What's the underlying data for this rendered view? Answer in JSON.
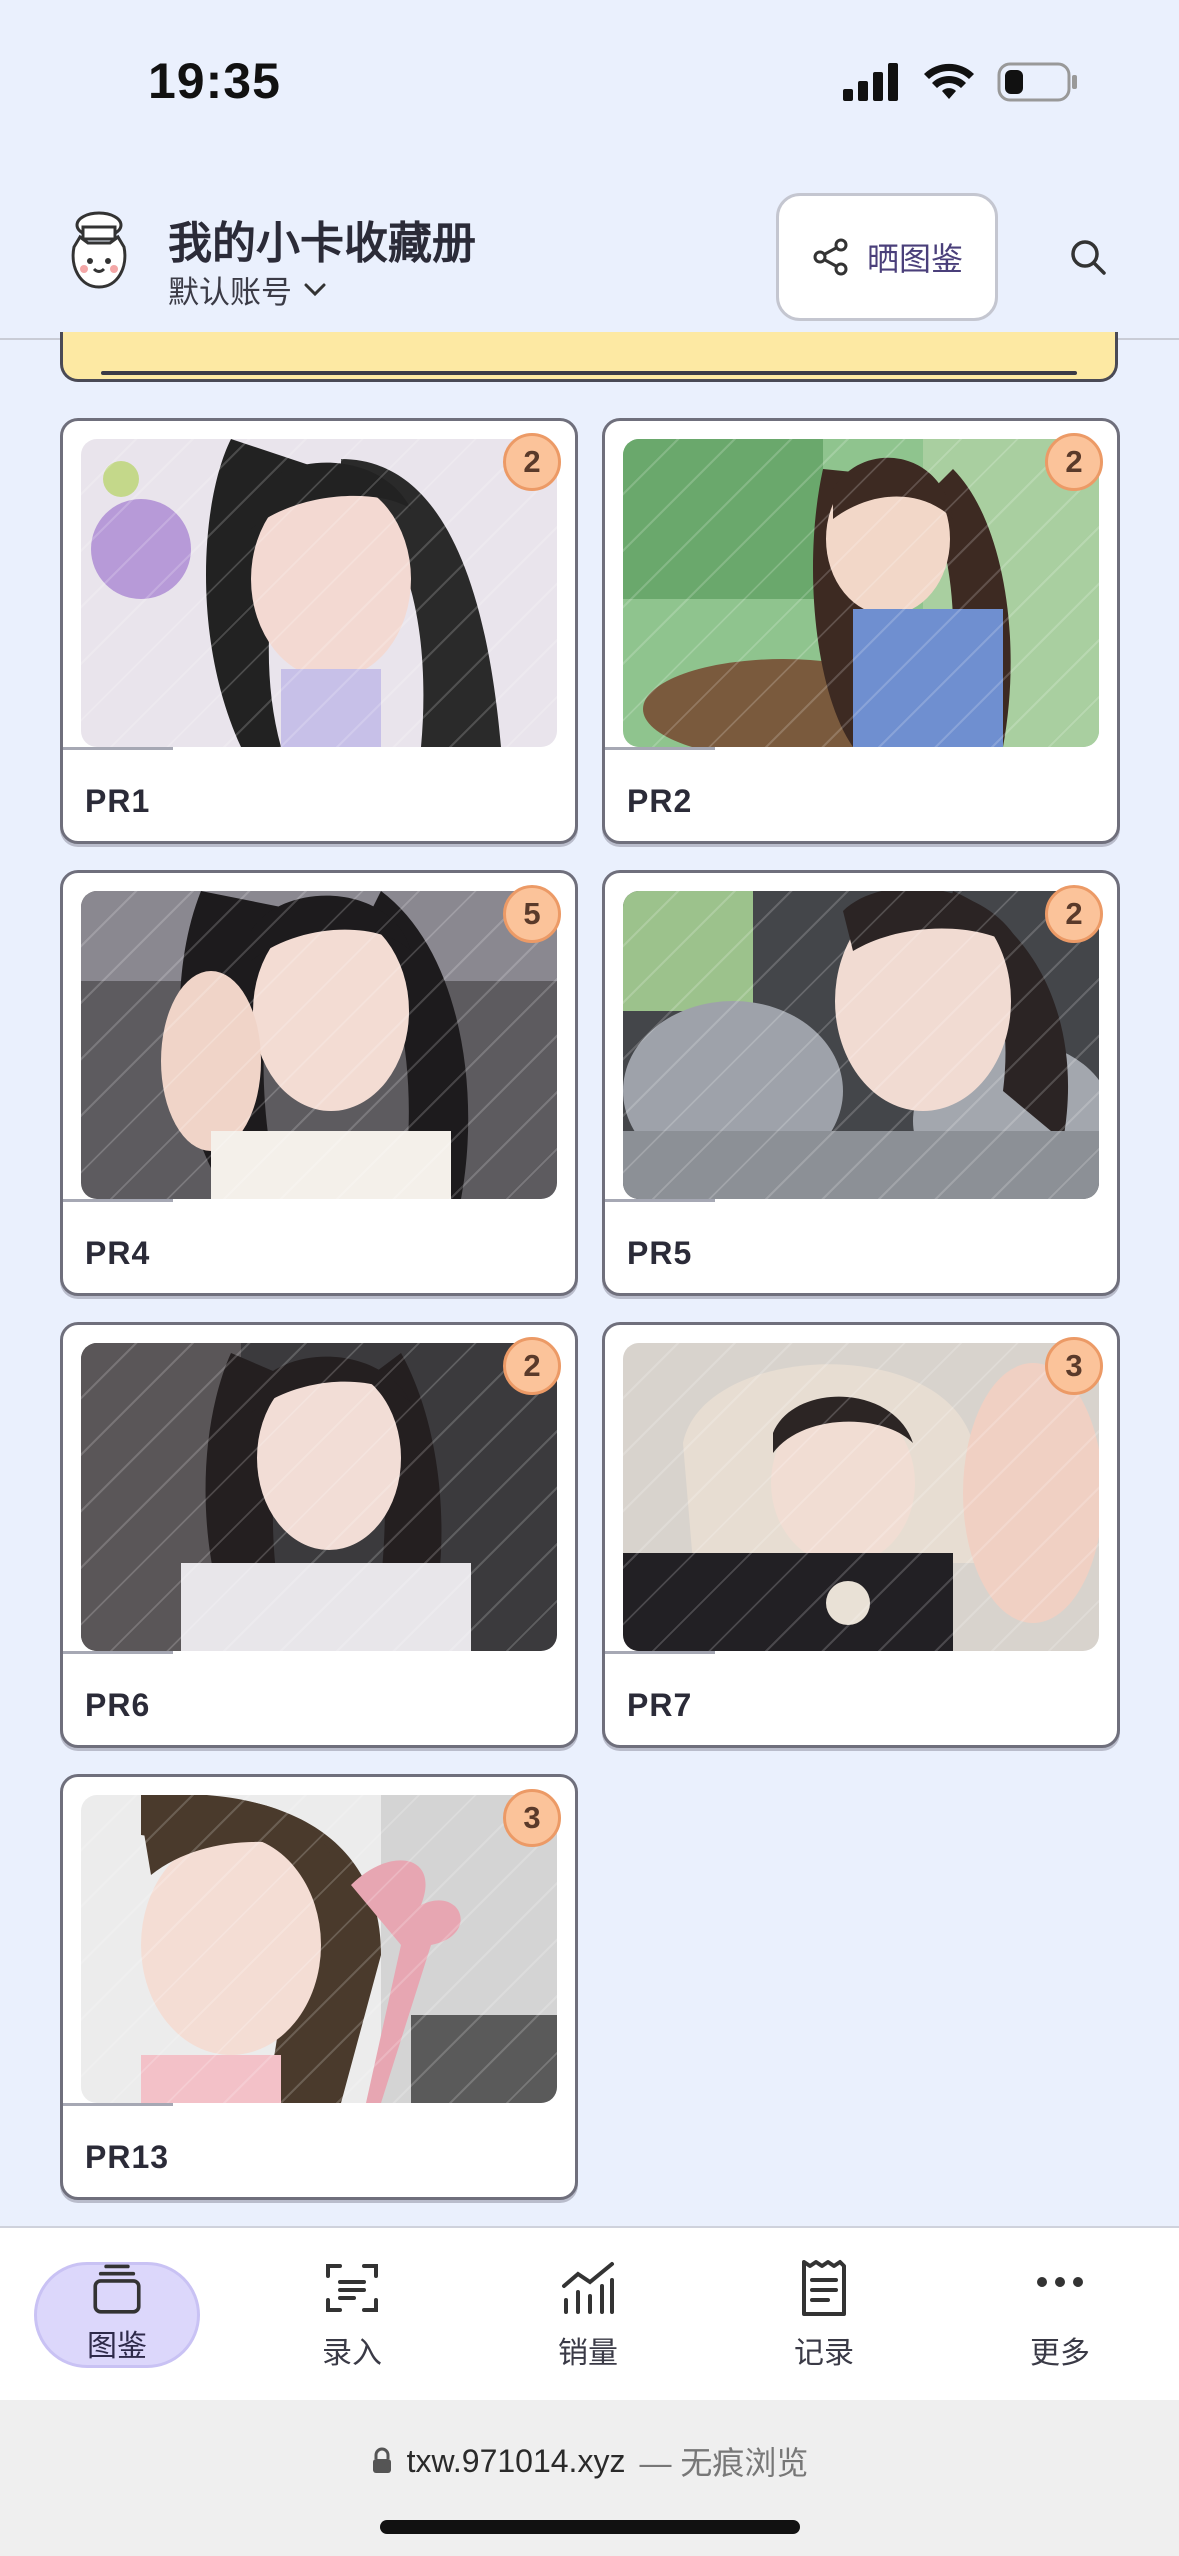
{
  "status_bar": {
    "time": "19:35"
  },
  "header": {
    "title": "我的小卡收藏册",
    "account": "默认账号",
    "share_label": "晒图鉴"
  },
  "cards": [
    {
      "label": "PR1",
      "count": "2"
    },
    {
      "label": "PR2",
      "count": "2"
    },
    {
      "label": "PR4",
      "count": "5"
    },
    {
      "label": "PR5",
      "count": "2"
    },
    {
      "label": "PR6",
      "count": "2"
    },
    {
      "label": "PR7",
      "count": "3"
    },
    {
      "label": "PR13",
      "count": "3"
    }
  ],
  "nav": [
    {
      "label": "图鉴",
      "icon": "stack-icon"
    },
    {
      "label": "录入",
      "icon": "scan-icon"
    },
    {
      "label": "销量",
      "icon": "chart-icon"
    },
    {
      "label": "记录",
      "icon": "receipt-icon"
    },
    {
      "label": "更多",
      "icon": "more-icon"
    }
  ],
  "browser": {
    "url": "txw.971014.xyz",
    "mode": "— 无痕浏览"
  },
  "colors": {
    "accent": "#dcd7fb",
    "badge": "#fbc39a",
    "banner": "#fde9a3",
    "background": "#eaf0fd"
  }
}
